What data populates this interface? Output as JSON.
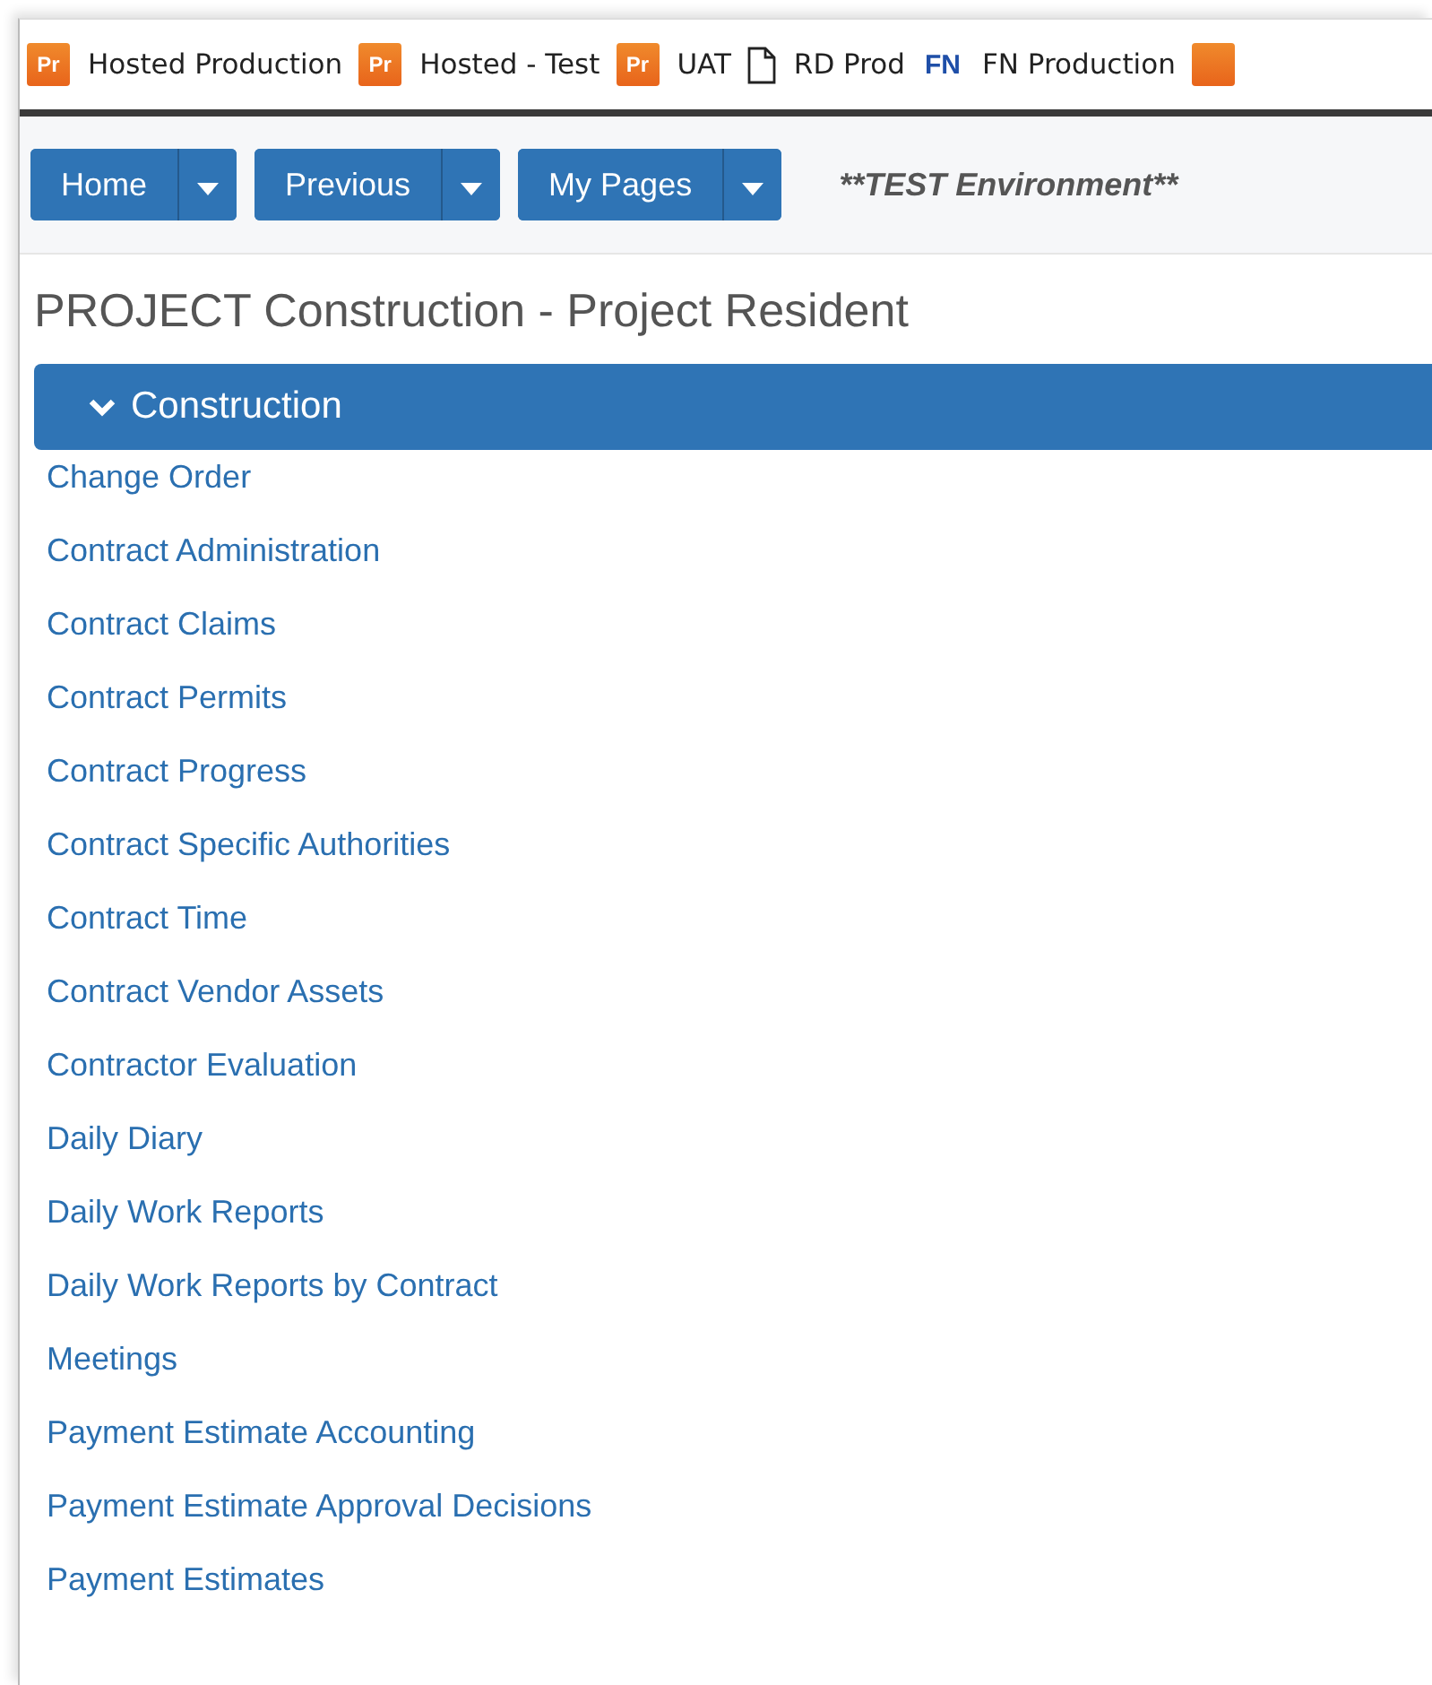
{
  "bookmarks": [
    {
      "kind": "pr",
      "icon_text": "Pr",
      "label": "Hosted Production"
    },
    {
      "kind": "pr",
      "icon_text": "Pr",
      "label": "Hosted - Test"
    },
    {
      "kind": "pr",
      "icon_text": "Pr",
      "label": "UAT"
    },
    {
      "kind": "page",
      "label": "RD Prod"
    },
    {
      "kind": "fn",
      "icon_text": "FN",
      "label": "FN Production"
    },
    {
      "kind": "pr"
    }
  ],
  "toolbar": {
    "buttons": [
      {
        "label": "Home"
      },
      {
        "label": "Previous"
      },
      {
        "label": "My Pages"
      }
    ],
    "environment": "**TEST Environment**"
  },
  "page_title": "PROJECT Construction - Project Resident",
  "section": {
    "title": "Construction",
    "expanded": true,
    "links": [
      "Change Order",
      "Contract Administration",
      "Contract Claims",
      "Contract Permits",
      "Contract Progress",
      "Contract Specific Authorities",
      "Contract Time",
      "Contract Vendor Assets",
      "Contractor Evaluation",
      "Daily Diary",
      "Daily Work Reports",
      "Daily Work Reports by Contract",
      "Meetings",
      "Payment Estimate Accounting",
      "Payment Estimate Approval Decisions",
      "Payment Estimates"
    ]
  }
}
